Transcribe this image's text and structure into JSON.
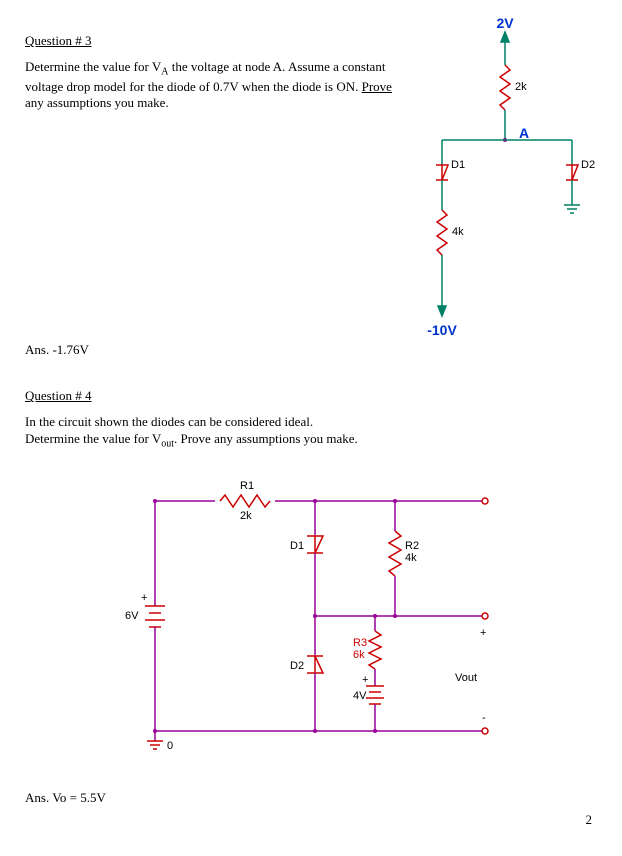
{
  "page_number": "2",
  "q3": {
    "title": "Question # 3",
    "body_p1": "Determine the value for V",
    "body_sub": "A",
    "body_p2": "  the voltage at node A.  Assume a constant voltage drop model for the diode of 0.7V when the diode is ON.   ",
    "body_prove": "Prove",
    "body_p3": " any assumptions you make.",
    "answer": "Ans. -1.76V",
    "circuit": {
      "top_v": "2V",
      "r_top": "2k",
      "node": "A",
      "d1": "D1",
      "d2": "D2",
      "r_mid": "4k",
      "bot_v": "-10V"
    }
  },
  "q4": {
    "title": "Question # 4",
    "body_p1": "In the circuit shown the diodes can be considered ideal.",
    "body_p2": "Determine the value for V",
    "body_sub": "out",
    "body_p3": ".  Prove any assumptions you make.",
    "answer": "Ans. Vo = 5.5V",
    "circuit": {
      "r1": "R1",
      "r1_val": "2k",
      "d1": "D1",
      "d2": "D2",
      "r2": "R2",
      "r2_val": "4k",
      "r3": "R3",
      "r3_val": "6k",
      "v_left": "6V",
      "v_mid": "4V",
      "vout": "Vout",
      "gnd": "0",
      "plus": "+",
      "minus": "-"
    }
  }
}
